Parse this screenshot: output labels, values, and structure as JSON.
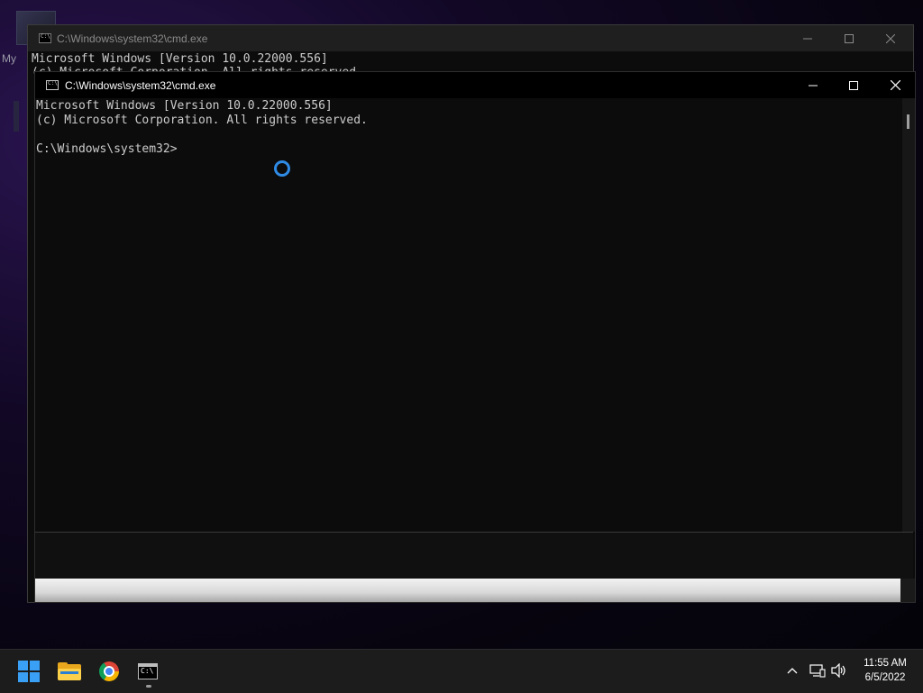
{
  "desktop": {
    "icon_label": "My"
  },
  "back_window": {
    "title": "C:\\Windows\\system32\\cmd.exe",
    "line1": "Microsoft Windows [Version 10.0.22000.556]",
    "line2_partial": "(c) Microsoft Corporation. All rights reserved."
  },
  "front_window": {
    "title": "C:\\Windows\\system32\\cmd.exe",
    "console_lines": [
      "Microsoft Windows [Version 10.0.22000.556]",
      "(c) Microsoft Corporation. All rights reserved.",
      "",
      "C:\\Windows\\system32>"
    ],
    "minimize_glyph": "—",
    "maximize_glyph": "☐",
    "close_glyph": "✕"
  },
  "taskbar": {
    "apps": [
      {
        "name": "start",
        "icon": "windows-logo-icon"
      },
      {
        "name": "file-explorer",
        "icon": "folder-icon"
      },
      {
        "name": "chrome",
        "icon": "chrome-icon"
      },
      {
        "name": "command-prompt",
        "icon": "terminal-icon"
      }
    ],
    "tray": {
      "chevron": "^",
      "network_icon": "network-icon",
      "volume_icon": "volume-icon"
    },
    "time": "11:55 AM",
    "date": "6/5/2022"
  },
  "colors": {
    "console_bg": "#0c0c0c",
    "console_text": "#cccccc",
    "accent": "#2f8be6",
    "taskbar_bg": "#1c1c1c"
  }
}
